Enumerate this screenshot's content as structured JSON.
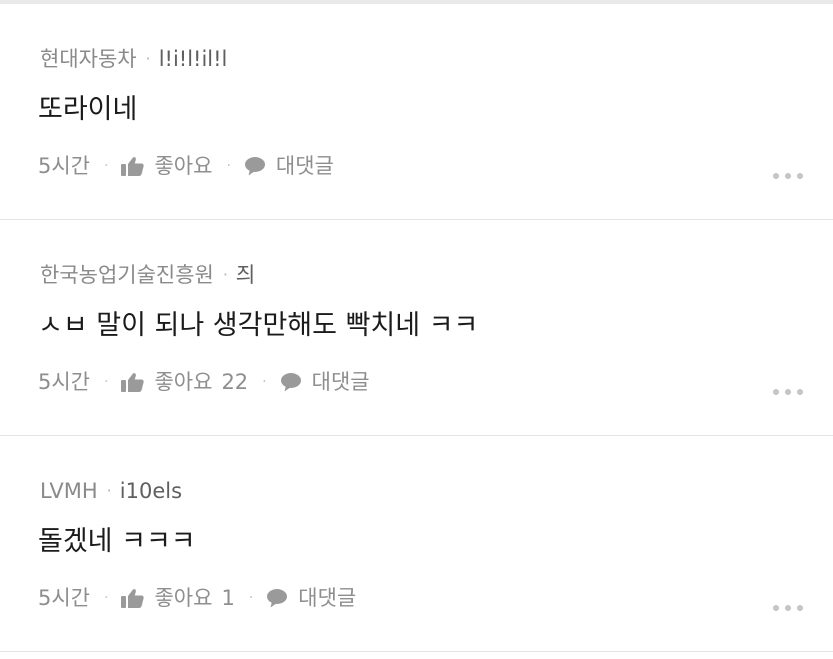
{
  "comments": [
    {
      "author": "현대자동차",
      "nickname": "l!i!l!il!l",
      "text": "또라이네",
      "time": "5시간",
      "like_label": "좋아요",
      "like_count": "",
      "reply_label": "대댓글"
    },
    {
      "author": "한국농업기술진흥원",
      "nickname": "즤",
      "text": "ㅅㅂ 말이 되나 생각만해도 빡치네 ㅋㅋ",
      "time": "5시간",
      "like_label": "좋아요",
      "like_count": "22",
      "reply_label": "대댓글"
    },
    {
      "author": "LVMH",
      "nickname": "i10els",
      "text": "돌겠네 ㅋㅋㅋ",
      "time": "5시간",
      "like_label": "좋아요",
      "like_count": "1",
      "reply_label": "대댓글"
    }
  ],
  "separator": "·",
  "icons": {
    "like": "thumbs-up-icon",
    "reply": "speech-bubble-icon",
    "more": "more-dots-icon"
  },
  "colors": {
    "author": "#8a8a8a",
    "nickname": "#5f5f5f",
    "text": "#1b1b1b",
    "meta": "#8e8e8e",
    "divider": "#e3e3e3"
  }
}
